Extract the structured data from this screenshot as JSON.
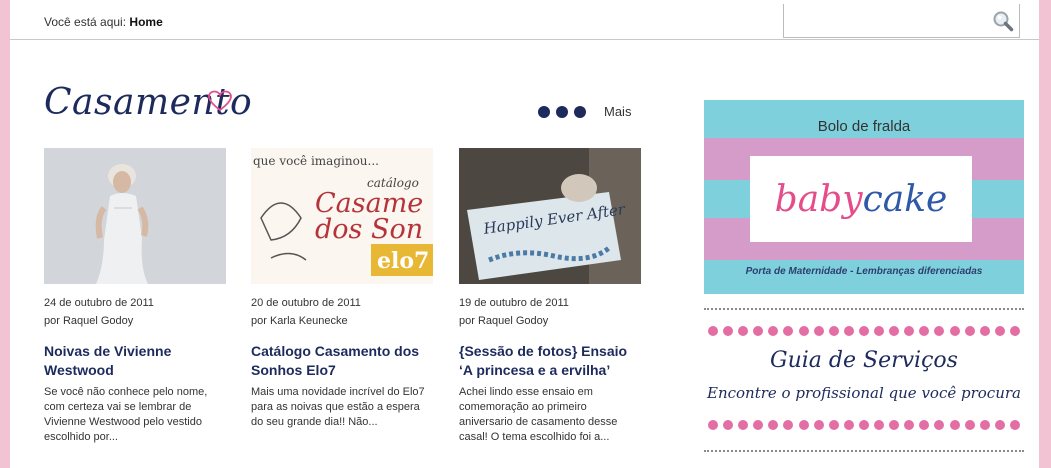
{
  "breadcrumb": {
    "prefix": "Você está aqui:",
    "current": "Home"
  },
  "search": {
    "placeholder": "",
    "icon": "magnifier-icon"
  },
  "section": {
    "title": "Casamento",
    "more_label": "Mais"
  },
  "posts": [
    {
      "date": "24 de outubro de 2011",
      "author": "por Raquel Godoy",
      "title": "Noivas de Vivienne Westwood",
      "excerpt": "Se você não conhece pelo nome, com certeza vai se lembrar de Vivienne Westwood pelo vestido escolhido por..."
    },
    {
      "date": "20 de outubro de 2011",
      "author": "por Karla Keunecke",
      "title": "Catálogo Casamento dos Sonhos Elo7",
      "excerpt": "Mais uma novidade incrível do Elo7 para as noivas que estão a espera do seu grande dia!! Não...",
      "thumb_text": {
        "line1": "que você imaginou...",
        "line2": "catálogo",
        "line3": "Casame",
        "line4": "dos Son",
        "badge": "elo7"
      }
    },
    {
      "date": "19 de outubro de 2011",
      "author": "por Raquel Godoy",
      "title": "{Sessão de fotos} Ensaio ‘A princesa e a ervilha’",
      "excerpt": "Achei lindo esse ensaio em comemoração ao primeiro aniversario de casamento desse casal! O tema escolhido foi a...",
      "thumb_text": {
        "sign": "Happily Ever After"
      }
    }
  ],
  "ads": {
    "babycake": {
      "top_label": "Bolo de fralda",
      "brand_part1": "baby",
      "brand_part2": "cake",
      "bottom_label": "Porta de Maternidade  - Lembranças diferenciadas"
    },
    "guide": {
      "title": "Guia de Serviços",
      "subtitle": "Encontre o profissional que você procura"
    }
  },
  "colors": {
    "background_pink": "#f2c3d3",
    "navy": "#1d2a5c",
    "ad_cyan": "#7ed0dd",
    "ad_pink": "#d59bc9",
    "dot_pink": "#e36ea4"
  }
}
